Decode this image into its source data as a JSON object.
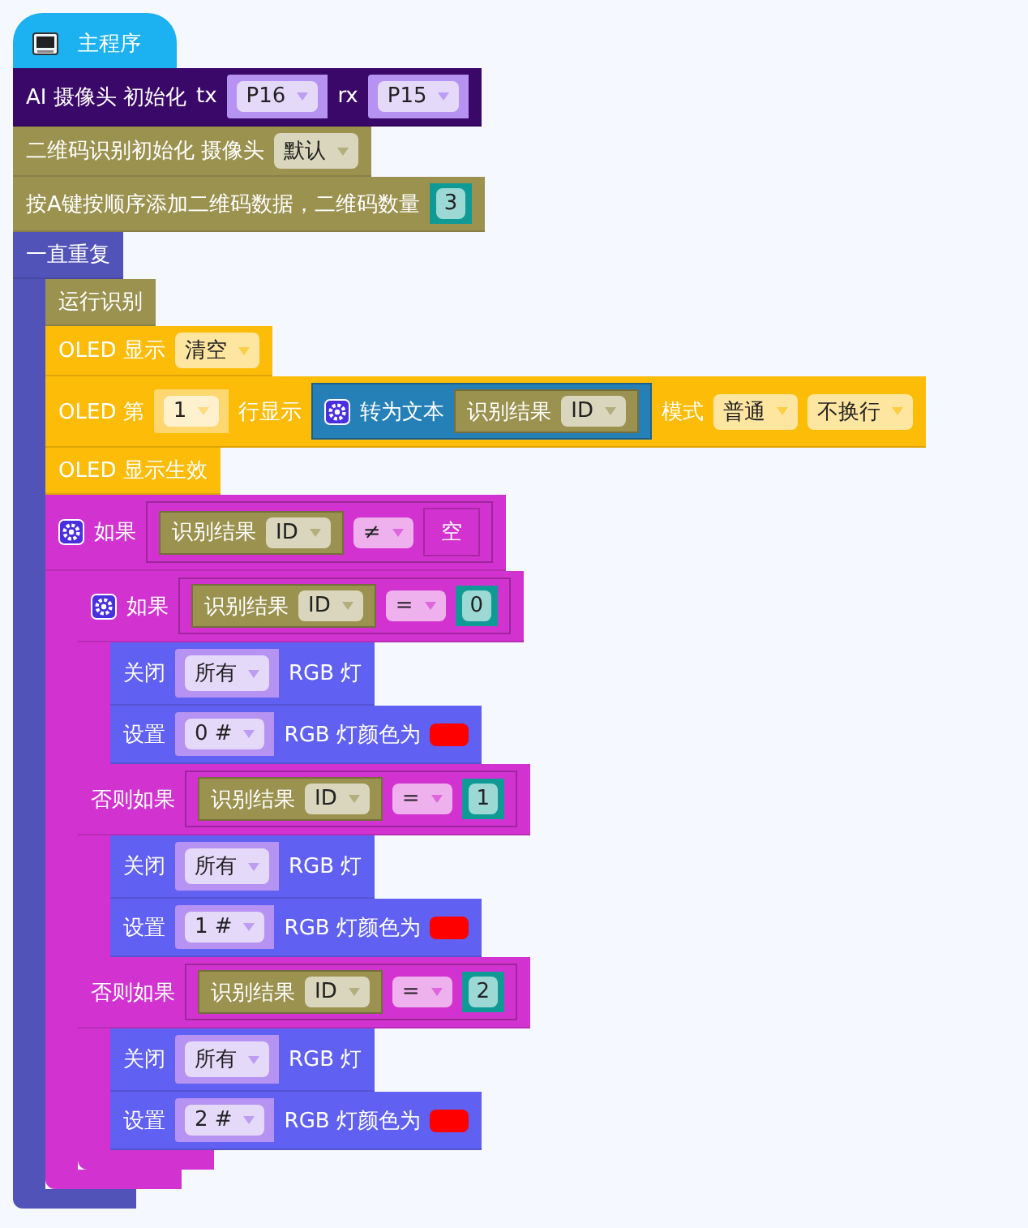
{
  "program": {
    "title": "主程序",
    "blocks": [
      {
        "kind": "statement",
        "color": "#3a0868",
        "parts": [
          {
            "kind": "label",
            "text": "AI 摄像头 初始化"
          },
          {
            "kind": "label",
            "text": "tx"
          },
          {
            "kind": "socket_dropdown",
            "color": "#b692f2",
            "text": "P16"
          },
          {
            "kind": "label",
            "text": "rx"
          },
          {
            "kind": "socket_dropdown",
            "color": "#b692f2",
            "text": "P15"
          }
        ]
      },
      {
        "kind": "statement",
        "color": "#9b9250",
        "parts": [
          {
            "kind": "label",
            "text": "二维码识别初始化 摄像头"
          },
          {
            "kind": "dropdown",
            "text": "默认"
          }
        ]
      },
      {
        "kind": "statement",
        "color": "#9b9250",
        "parts": [
          {
            "kind": "label",
            "text": "按A键按顺序添加二维码数据，二维码数量"
          },
          {
            "kind": "number",
            "text": "3"
          }
        ]
      },
      {
        "kind": "loop",
        "color": "#5253b8",
        "parts": [
          {
            "kind": "label",
            "text": "一直重复"
          }
        ],
        "body": [
          {
            "kind": "statement",
            "color": "#9b9250",
            "parts": [
              {
                "kind": "label",
                "text": "运行识别"
              }
            ]
          },
          {
            "kind": "statement",
            "color": "#fdbc08",
            "parts": [
              {
                "kind": "label",
                "text": "OLED 显示"
              },
              {
                "kind": "dropdown",
                "text": "清空"
              }
            ]
          },
          {
            "kind": "statement",
            "color": "#fdbc08",
            "parts": [
              {
                "kind": "label",
                "text": "OLED 第"
              },
              {
                "kind": "socket_dropdown",
                "color": "#ffd770",
                "text": "1"
              },
              {
                "kind": "label",
                "text": "行显示"
              },
              {
                "kind": "block",
                "color": "#2680b8",
                "parts": [
                  {
                    "kind": "mutator"
                  },
                  {
                    "kind": "label",
                    "text": "转为文本"
                  },
                  {
                    "kind": "block",
                    "color": "#9b9250",
                    "parts": [
                      {
                        "kind": "label",
                        "text": "识别结果"
                      },
                      {
                        "kind": "dropdown",
                        "text": "ID"
                      }
                    ]
                  }
                ]
              },
              {
                "kind": "label",
                "text": "模式"
              },
              {
                "kind": "dropdown",
                "text": "普通"
              },
              {
                "kind": "dropdown",
                "text": "不换行"
              }
            ]
          },
          {
            "kind": "statement",
            "color": "#fdbc08",
            "parts": [
              {
                "kind": "label",
                "text": "OLED 显示生效"
              }
            ]
          },
          {
            "kind": "if",
            "color": "#d233d0",
            "branches": [
              {
                "parts": [
                  {
                    "kind": "mutator"
                  },
                  {
                    "kind": "label",
                    "text": "如果"
                  },
                  {
                    "kind": "block",
                    "parts": [
                      {
                        "kind": "block",
                        "color": "#9b9250",
                        "parts": [
                          {
                            "kind": "label",
                            "text": "识别结果"
                          },
                          {
                            "kind": "dropdown",
                            "text": "ID"
                          }
                        ]
                      },
                      {
                        "kind": "dropdown",
                        "text": "≠"
                      },
                      {
                        "kind": "text",
                        "text": "空"
                      }
                    ]
                  }
                ],
                "body": [
                  {
                    "kind": "if",
                    "color": "#d233d0",
                    "branches": [
                      {
                        "parts": [
                          {
                            "kind": "mutator"
                          },
                          {
                            "kind": "label",
                            "text": "如果"
                          },
                          {
                            "kind": "block",
                            "parts": [
                              {
                                "kind": "block",
                                "color": "#9b9250",
                                "parts": [
                                  {
                                    "kind": "label",
                                    "text": "识别结果"
                                  },
                                  {
                                    "kind": "dropdown",
                                    "text": "ID"
                                  }
                                ]
                              },
                              {
                                "kind": "dropdown",
                                "text": "="
                              },
                              {
                                "kind": "number",
                                "text": "0"
                              }
                            ]
                          }
                        ],
                        "body": [
                          {
                            "kind": "statement",
                            "color": "#6060f2",
                            "parts": [
                              {
                                "kind": "label",
                                "text": "关闭"
                              },
                              {
                                "kind": "socket_dropdown",
                                "color": "#b692f2",
                                "text": "所有"
                              },
                              {
                                "kind": "label",
                                "text": "RGB 灯"
                              }
                            ]
                          },
                          {
                            "kind": "statement",
                            "color": "#6060f2",
                            "parts": [
                              {
                                "kind": "label",
                                "text": "设置"
                              },
                              {
                                "kind": "socket_dropdown",
                                "color": "#b692f2",
                                "text": "0 #"
                              },
                              {
                                "kind": "label",
                                "text": "RGB 灯颜色为"
                              },
                              {
                                "kind": "color",
                                "color": "#ff0000"
                              }
                            ]
                          }
                        ]
                      },
                      {
                        "parts": [
                          {
                            "kind": "label",
                            "text": "否则如果"
                          },
                          {
                            "kind": "block",
                            "parts": [
                              {
                                "kind": "block",
                                "color": "#9b9250",
                                "parts": [
                                  {
                                    "kind": "label",
                                    "text": "识别结果"
                                  },
                                  {
                                    "kind": "dropdown",
                                    "text": "ID"
                                  }
                                ]
                              },
                              {
                                "kind": "dropdown",
                                "text": "="
                              },
                              {
                                "kind": "number",
                                "text": "1"
                              }
                            ]
                          }
                        ],
                        "body": [
                          {
                            "kind": "statement",
                            "color": "#6060f2",
                            "parts": [
                              {
                                "kind": "label",
                                "text": "关闭"
                              },
                              {
                                "kind": "socket_dropdown",
                                "color": "#b692f2",
                                "text": "所有"
                              },
                              {
                                "kind": "label",
                                "text": "RGB 灯"
                              }
                            ]
                          },
                          {
                            "kind": "statement",
                            "color": "#6060f2",
                            "parts": [
                              {
                                "kind": "label",
                                "text": "设置"
                              },
                              {
                                "kind": "socket_dropdown",
                                "color": "#b692f2",
                                "text": "1 #"
                              },
                              {
                                "kind": "label",
                                "text": "RGB 灯颜色为"
                              },
                              {
                                "kind": "color",
                                "color": "#ff0000"
                              }
                            ]
                          }
                        ]
                      },
                      {
                        "parts": [
                          {
                            "kind": "label",
                            "text": "否则如果"
                          },
                          {
                            "kind": "block",
                            "parts": [
                              {
                                "kind": "block",
                                "color": "#9b9250",
                                "parts": [
                                  {
                                    "kind": "label",
                                    "text": "识别结果"
                                  },
                                  {
                                    "kind": "dropdown",
                                    "text": "ID"
                                  }
                                ]
                              },
                              {
                                "kind": "dropdown",
                                "text": "="
                              },
                              {
                                "kind": "number",
                                "text": "2"
                              }
                            ]
                          }
                        ],
                        "body": [
                          {
                            "kind": "statement",
                            "color": "#6060f2",
                            "parts": [
                              {
                                "kind": "label",
                                "text": "关闭"
                              },
                              {
                                "kind": "socket_dropdown",
                                "color": "#b692f2",
                                "text": "所有"
                              },
                              {
                                "kind": "label",
                                "text": "RGB 灯"
                              }
                            ]
                          },
                          {
                            "kind": "statement",
                            "color": "#6060f2",
                            "parts": [
                              {
                                "kind": "label",
                                "text": "设置"
                              },
                              {
                                "kind": "socket_dropdown",
                                "color": "#b692f2",
                                "text": "2 #"
                              },
                              {
                                "kind": "label",
                                "text": "RGB 灯颜色为"
                              },
                              {
                                "kind": "color",
                                "color": "#ff0000"
                              }
                            ]
                          }
                        ]
                      }
                    ]
                  }
                ]
              }
            ]
          }
        ]
      }
    ]
  }
}
